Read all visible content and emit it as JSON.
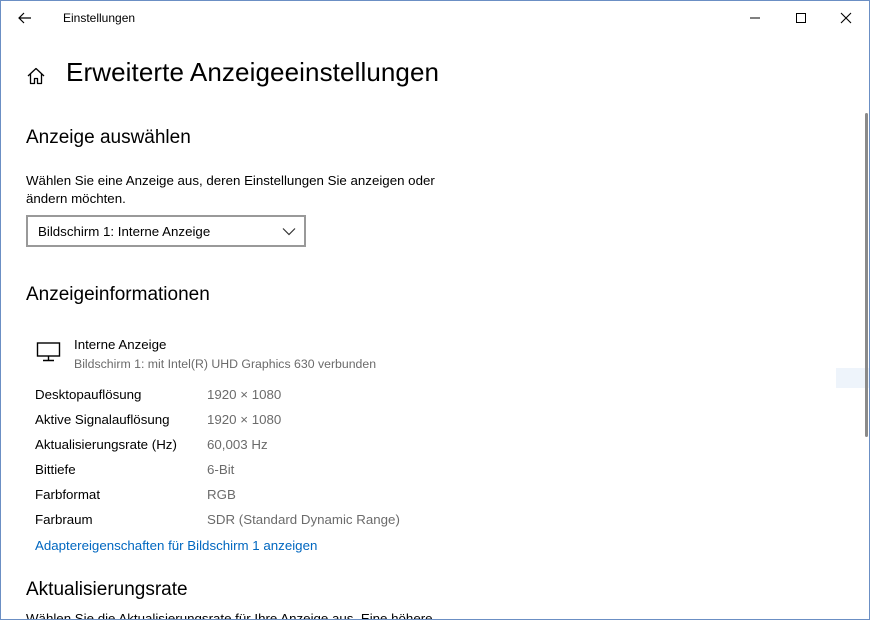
{
  "window": {
    "app_title": "Einstellungen"
  },
  "header": {
    "page_title": "Erweiterte Anzeigeeinstellungen"
  },
  "select_display": {
    "heading": "Anzeige auswählen",
    "description": "Wählen Sie eine Anzeige aus, deren Einstellungen Sie anzeigen oder ändern möchten.",
    "dropdown_value": "Bildschirm 1: Interne Anzeige"
  },
  "display_info": {
    "heading": "Anzeigeinformationen",
    "display_name": "Interne Anzeige",
    "display_sub": "Bildschirm 1: mit Intel(R) UHD Graphics 630 verbunden",
    "rows": [
      {
        "label": "Desktopauflösung",
        "value": "1920 × 1080"
      },
      {
        "label": "Aktive Signalauflösung",
        "value": "1920 × 1080"
      },
      {
        "label": "Aktualisierungsrate (Hz)",
        "value": "60,003 Hz"
      },
      {
        "label": "Bittiefe",
        "value": "6-Bit"
      },
      {
        "label": "Farbformat",
        "value": "RGB"
      },
      {
        "label": "Farbraum",
        "value": "SDR (Standard Dynamic Range)"
      }
    ],
    "adapter_link": "Adaptereigenschaften für Bildschirm 1 anzeigen"
  },
  "refresh_rate": {
    "heading": "Aktualisierungsrate",
    "description_partial": "Wählen Sie die Aktualisierungsrate für Ihre Anzeige aus. Eine höhere"
  },
  "icons": {
    "back": "back-arrow-icon",
    "minimize": "minimize-icon",
    "maximize": "maximize-icon",
    "close": "close-icon",
    "home": "home-icon",
    "chevron": "chevron-down-icon",
    "monitor": "monitor-icon"
  },
  "colors": {
    "link": "#0067c0",
    "secondary_text": "#6b6b6b",
    "window_border": "#6b8fc4"
  }
}
